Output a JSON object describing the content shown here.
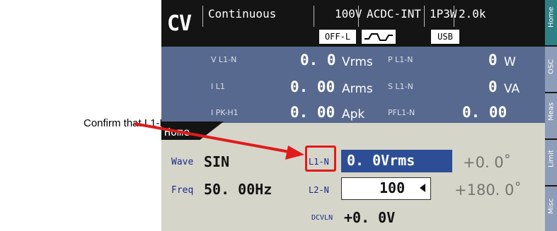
{
  "annotation": {
    "text": "Confirm that L1-N."
  },
  "header": {
    "mode": "CV",
    "continuous": "Continuous",
    "voltage_range": "100V",
    "source": "ACDC-INT",
    "phase_config": "1P3W",
    "frequency_range": "2.0k",
    "output_state": "OFF-L",
    "usb": "USB"
  },
  "measurements": {
    "v_label": "V L1-N",
    "v_value": "0. 0",
    "v_unit": "Vrms",
    "i_label": "I L1",
    "i_value": "0. 00",
    "i_unit": "Arms",
    "ipk_label": "I PK-H1",
    "ipk_value": "0. 00",
    "ipk_unit": "Apk",
    "p_label": "P L1-N",
    "p_value": "0",
    "p_unit": "W",
    "s_label": "S L1-N",
    "s_value": "0",
    "s_unit": "VA",
    "pf_label": "PFL1-N",
    "pf_value": "0. 00"
  },
  "home": {
    "tab_label": "Home",
    "wave_label": "Wave",
    "wave_value": "SIN",
    "freq_label": "Freq",
    "freq_value": "50. 00Hz",
    "l1n_label": "L1-N",
    "l1n_value": "0. 0Vrms",
    "l1n_phase": "+0. 0˚",
    "l2n_label": "L2-N",
    "l2n_value": "100",
    "l2n_phase": "+180. 0˚",
    "dcv_label": "DCVLN",
    "dcv_value": "+0. 0V"
  },
  "side_menu": [
    "Home",
    "OSC",
    "Meas",
    "Limit",
    "Misc"
  ],
  "colors": {
    "header": "#141414",
    "measure_panel": "#57698f",
    "selected": "#2d4e96",
    "highlight": "#e01b1b",
    "side_active": "#2f7f86",
    "side_inactive": "#8d9cb8"
  }
}
